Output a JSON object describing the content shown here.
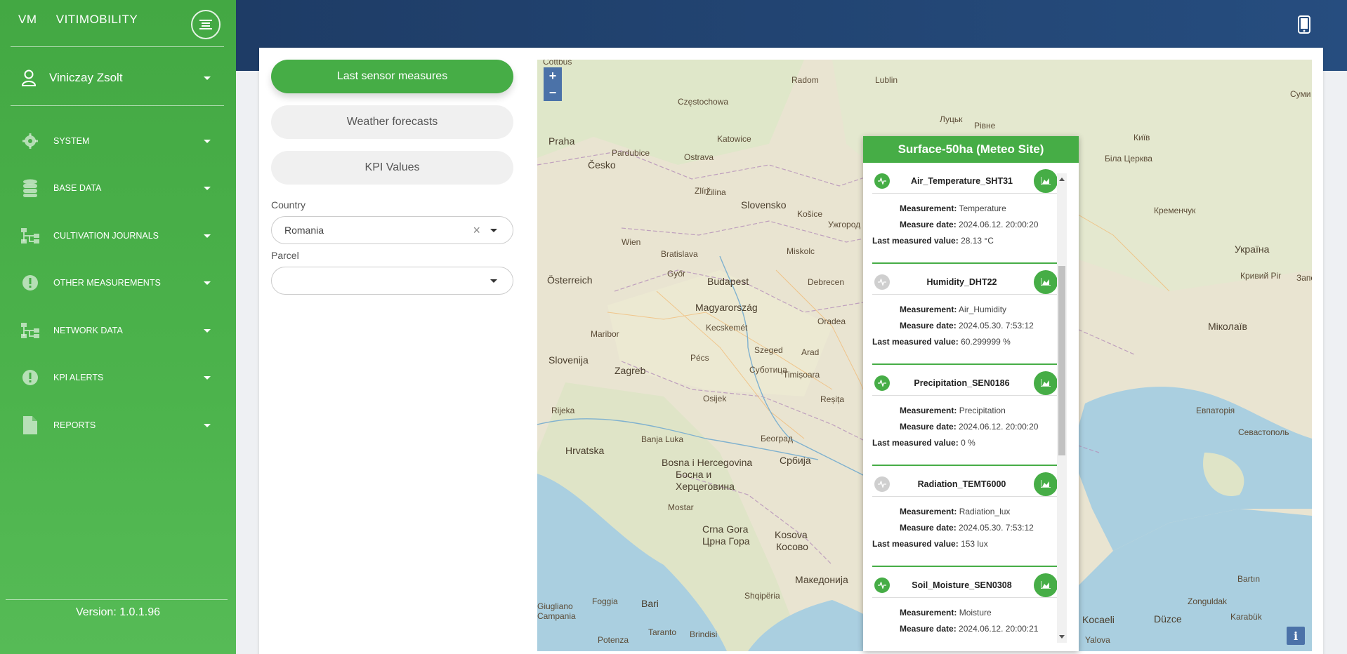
{
  "brand": {
    "mini": "VM",
    "name": "VITIMOBILITY"
  },
  "user": {
    "name": "Viniczay Zsolt"
  },
  "nav": [
    {
      "label": "SYSTEM",
      "icon": "gear-icon"
    },
    {
      "label": "BASE DATA",
      "icon": "database-icon"
    },
    {
      "label": "CULTIVATION JOURNALS",
      "icon": "sitemap-icon"
    },
    {
      "label": "OTHER MEASUREMENTS",
      "icon": "exclamation-circle-icon"
    },
    {
      "label": "NETWORK DATA",
      "icon": "sitemap-icon"
    },
    {
      "label": "KPI ALERTS",
      "icon": "exclamation-circle-icon"
    },
    {
      "label": "REPORTS",
      "icon": "file-icon"
    }
  ],
  "version": "Version:  1.0.1.96",
  "tabs": [
    "Last sensor measures",
    "Weather forecasts",
    "KPI Values"
  ],
  "filters": {
    "country_label": "Country",
    "country_value": "Romania",
    "parcel_label": "Parcel",
    "parcel_value": ""
  },
  "map": {
    "zoom_in": "+",
    "zoom_out": "−",
    "info": "i",
    "labels": [
      "Cottbus",
      "Radom",
      "Lublin",
      "Praha",
      "Częstochowa",
      "Katowice",
      "Луцьк",
      "Рівне",
      "Київ",
      "Суми",
      "Česko",
      "Pardubice",
      "Ostrava",
      "Біла Церква",
      "Zlín",
      "Žilina",
      "Slovensko",
      "Košice",
      "Ужгород",
      "Кременчук",
      "Wien",
      "Bratislava",
      "Miskolc",
      "Україна",
      "Österreich",
      "Győr",
      "Budapest",
      "Debrecen",
      "Кривий Ріг",
      "Запорі",
      "Magyarország",
      "Oradea",
      "Miкoлaїв",
      "Maribor",
      "Kecskemét",
      "Pécs",
      "Szeged",
      "Arad",
      "Slovenija",
      "Zagreb",
      "Суботица",
      "Timișoara",
      "Osijek",
      "Reșița",
      "Rijeka",
      "Hrvatska",
      "Banja Luka",
      "Београд",
      "Bosna i Hercegovina",
      "Босна и",
      "Херцеговина",
      "Србија",
      "Евпаторія",
      "Севастополь",
      "Mostar",
      "Crna Gora",
      "Црна Гора",
      "Kosova",
      "Косово",
      "Shqipëria",
      "Македонија",
      "Bari",
      "Foggia",
      "Giugliano",
      "Campania",
      "Taranto",
      "Brindisi",
      "Potenza",
      "Kocaeli",
      "Düzce",
      "Zonguldak",
      "Karabük",
      "Bartın",
      "Yalova"
    ],
    "popup": {
      "title": "Surface-50ha (Meteo Site)",
      "sensors": [
        {
          "name": "Air_Temperature_SHT31",
          "status": "online",
          "measurement_label": "Measurement:",
          "measurement": "Temperature",
          "date_label": "Measure date:",
          "date": "2024.06.12. 20:00:20",
          "value_label": "Last measured value:",
          "value": "28.13 °C"
        },
        {
          "name": "Humidity_DHT22",
          "status": "offline",
          "measurement_label": "Measurement:",
          "measurement": "Air_Humidity",
          "date_label": "Measure date:",
          "date": "2024.05.30. 7:53:12",
          "value_label": "Last measured value:",
          "value": "60.299999 %"
        },
        {
          "name": "Precipitation_SEN0186",
          "status": "online",
          "measurement_label": "Measurement:",
          "measurement": "Precipitation",
          "date_label": "Measure date:",
          "date": "2024.06.12. 20:00:20",
          "value_label": "Last measured value:",
          "value": "0 %"
        },
        {
          "name": "Radiation_TEMT6000",
          "status": "offline",
          "measurement_label": "Measurement:",
          "measurement": "Radiation_lux",
          "date_label": "Measure date:",
          "date": "2024.05.30. 7:53:12",
          "value_label": "Last measured value:",
          "value": "153 lux"
        },
        {
          "name": "Soil_Moisture_SEN0308",
          "status": "online",
          "measurement_label": "Measurement:",
          "measurement": "Moisture",
          "date_label": "Measure date:",
          "date": "2024.06.12. 20:00:21",
          "value_label": "Last measured value:",
          "value": ""
        }
      ]
    }
  }
}
